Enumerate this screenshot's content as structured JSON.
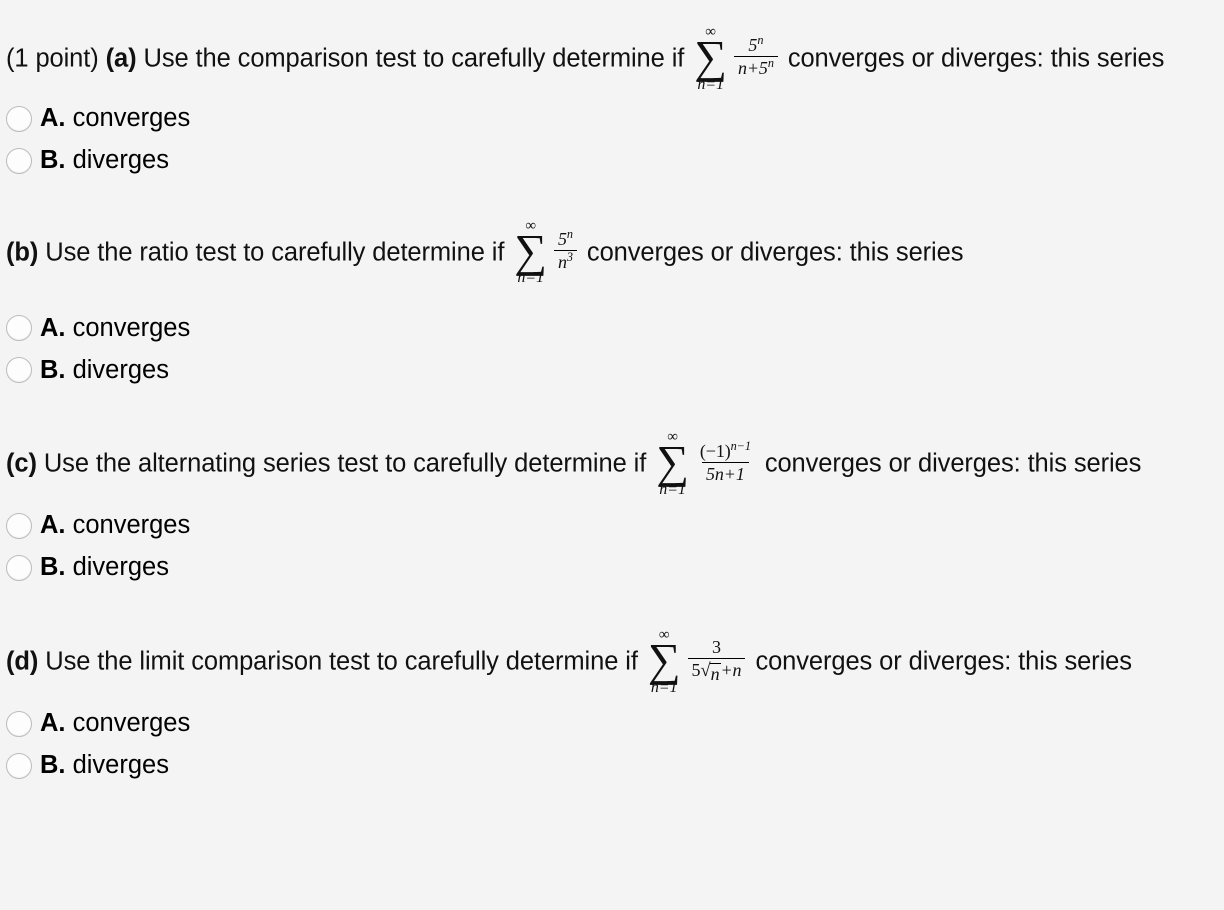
{
  "page": {
    "background_color": "#f4f4f4",
    "text_color": "#111111",
    "radio_border_color": "#bcbcbc"
  },
  "problems": [
    {
      "lead": "(1 point) ",
      "part": "(a)",
      "text_before": " Use the comparison test to carefully determine if ",
      "math": {
        "sum_top": "∞",
        "sum_glyph": "∑",
        "sum_bottom": "n=1",
        "numerator": "5",
        "numerator_exp": "n",
        "denominator": "n+5",
        "denominator_exp": "n",
        "latex": "\\sum_{n=1}^{\\infty} \\frac{5^n}{n+5^n}"
      },
      "text_after": " converges or diverges: this series",
      "choices": [
        {
          "key": "A.",
          "label": " converges",
          "selected": false
        },
        {
          "key": "B.",
          "label": " diverges",
          "selected": false
        }
      ]
    },
    {
      "lead": "",
      "part": "(b)",
      "text_before": " Use the ratio test to carefully determine if ",
      "math": {
        "sum_top": "∞",
        "sum_glyph": "∑",
        "sum_bottom": "n=1",
        "numerator": "5",
        "numerator_exp": "n",
        "denominator": "n",
        "denominator_exp": "3",
        "latex": "\\sum_{n=1}^{\\infty} \\frac{5^n}{n^3}"
      },
      "text_after": " converges or diverges: this series",
      "choices": [
        {
          "key": "A.",
          "label": " converges",
          "selected": false
        },
        {
          "key": "B.",
          "label": " diverges",
          "selected": false
        }
      ]
    },
    {
      "lead": "",
      "part": "(c)",
      "text_before": " Use the alternating series test to carefully determine if ",
      "math": {
        "sum_top": "∞",
        "sum_glyph": "∑",
        "sum_bottom": "n=1",
        "numerator": "(−1)",
        "numerator_exp": "n−1",
        "denominator": "5n+1",
        "denominator_exp": "",
        "latex": "\\sum_{n=1}^{\\infty} \\frac{(-1)^{n-1}}{5n+1}"
      },
      "text_after": " converges or diverges: this series",
      "choices": [
        {
          "key": "A.",
          "label": " converges",
          "selected": false
        },
        {
          "key": "B.",
          "label": " diverges",
          "selected": false
        }
      ]
    },
    {
      "lead": "",
      "part": "(d)",
      "text_before": " Use the limit comparison test to carefully determine if ",
      "math": {
        "sum_top": "∞",
        "sum_glyph": "∑",
        "sum_bottom": "n=1",
        "numerator": "3",
        "numerator_exp": "",
        "denominator_prefix": "5",
        "denominator_radicand": "n",
        "denominator_suffix": "+n",
        "latex": "\\sum_{n=1}^{\\infty} \\frac{3}{5\\sqrt{n}+n}"
      },
      "text_after": " converges or diverges: this series",
      "choices": [
        {
          "key": "A.",
          "label": " converges",
          "selected": false
        },
        {
          "key": "B.",
          "label": " diverges",
          "selected": false
        }
      ]
    }
  ]
}
